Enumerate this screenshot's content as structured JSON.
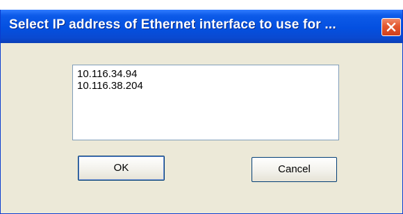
{
  "dialog": {
    "title": "Select IP address of Ethernet interface to use for ...",
    "close_icon": "close-icon"
  },
  "ip_list": {
    "items": [
      {
        "label": "10.116.34.94"
      },
      {
        "label": "10.116.38.204"
      }
    ]
  },
  "buttons": {
    "ok_label": "OK",
    "cancel_label": "Cancel"
  },
  "colors": {
    "titlebar": "#0450e0",
    "window_bg": "#ece9d8",
    "close_button": "#e3572e"
  }
}
